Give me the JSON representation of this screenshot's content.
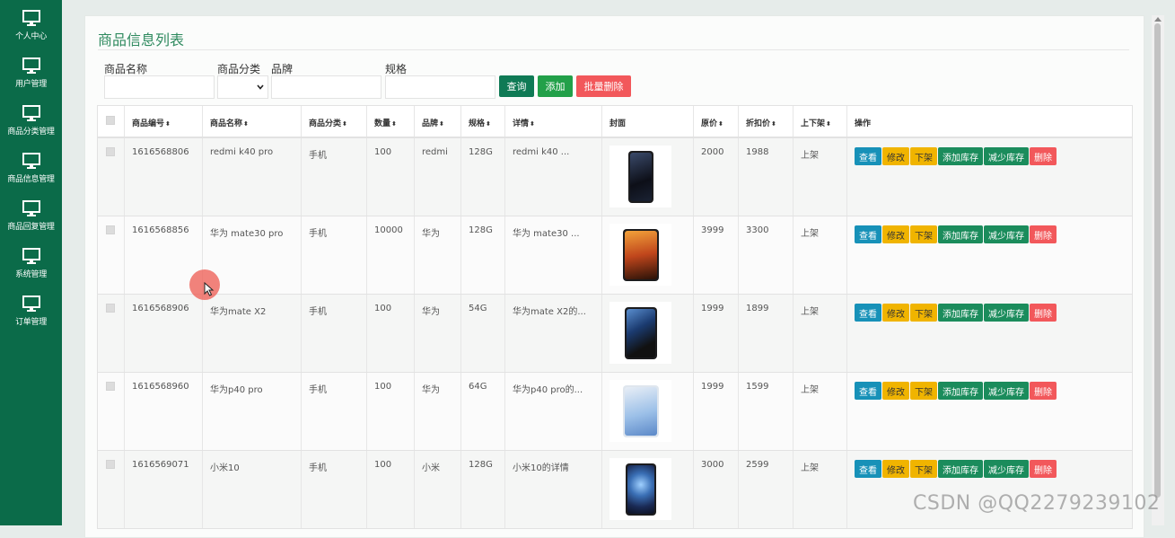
{
  "sidebar": {
    "items": [
      {
        "label": "个人中心",
        "icon": "monitor-icon"
      },
      {
        "label": "用户管理",
        "icon": "monitor-icon"
      },
      {
        "label": "商品分类管理",
        "icon": "monitor-icon"
      },
      {
        "label": "商品信息管理",
        "icon": "monitor-icon"
      },
      {
        "label": "商品回复管理",
        "icon": "monitor-icon"
      },
      {
        "label": "系统管理",
        "icon": "monitor-icon"
      },
      {
        "label": "订单管理",
        "icon": "monitor-icon"
      }
    ]
  },
  "page": {
    "title": "商品信息列表"
  },
  "filters": {
    "name_label": "商品名称",
    "category_label": "商品分类",
    "brand_label": "品牌",
    "spec_label": "规格",
    "category_value": "",
    "search_btn": "查询",
    "add_btn": "添加",
    "batch_delete_btn": "批量删除"
  },
  "table": {
    "headers": [
      "商品编号",
      "商品名称",
      "商品分类",
      "数量",
      "品牌",
      "规格",
      "详情",
      "封面",
      "原价",
      "折扣价",
      "上下架",
      "操作"
    ],
    "rows": [
      {
        "id": "1616568806",
        "name": "redmi k40 pro",
        "category": "手机",
        "qty": "100",
        "brand": "redmi",
        "spec": "128G",
        "detail": "redmi k40 ...",
        "price": "2000",
        "discount": "1988",
        "status": "上架"
      },
      {
        "id": "1616568856",
        "name": "华为 mate30 pro",
        "category": "手机",
        "qty": "10000",
        "brand": "华为",
        "spec": "128G",
        "detail": "华为 mate30 ...",
        "price": "3999",
        "discount": "3300",
        "status": "上架"
      },
      {
        "id": "1616568906",
        "name": "华为mate X2",
        "category": "手机",
        "qty": "100",
        "brand": "华为",
        "spec": "54G",
        "detail": "华为mate X2的...",
        "price": "1999",
        "discount": "1899",
        "status": "上架"
      },
      {
        "id": "1616568960",
        "name": "华为p40 pro",
        "category": "手机",
        "qty": "100",
        "brand": "华为",
        "spec": "64G",
        "detail": "华为p40 pro的...",
        "price": "1999",
        "discount": "1599",
        "status": "上架"
      },
      {
        "id": "1616569071",
        "name": "小米10",
        "category": "手机",
        "qty": "100",
        "brand": "小米",
        "spec": "128G",
        "detail": "小米10的详情",
        "price": "3000",
        "discount": "2599",
        "status": "上架"
      }
    ],
    "actions": {
      "view": "查看",
      "edit": "修改",
      "offshelf": "下架",
      "add_stock": "添加库存",
      "reduce_stock": "减少库存",
      "delete": "删除"
    }
  },
  "watermark": "CSDN @QQ2279239102",
  "colors": {
    "sidebar": "#0b6b49",
    "title": "#2f8a5f",
    "view": "#1791b8",
    "edit": "#f0b400",
    "stock": "#1b8c5c",
    "delete": "#f2585b"
  }
}
